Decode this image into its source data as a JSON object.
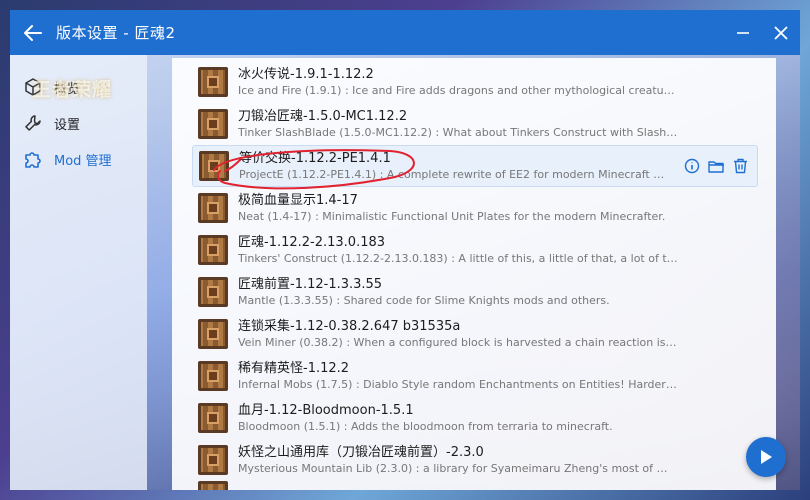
{
  "window": {
    "title": "版本设置 - 匠魂2",
    "accent": "#1f6fd1"
  },
  "sidebar": {
    "watermark": "王者荣耀",
    "items": [
      {
        "label": "概览",
        "icon": "cube-icon"
      },
      {
        "label": "设置",
        "icon": "wrench-icon"
      },
      {
        "label": "Mod 管理",
        "icon": "puzzle-icon",
        "active": true
      }
    ]
  },
  "mods": [
    {
      "name": "冰火传说-1.9.1-1.12.2",
      "desc": "Ice and Fire (1.9.1) : Ice and Fire adds dragons and other mythological creature..."
    },
    {
      "name": "刀锻冶匠魂-1.5.0-MC1.12.2",
      "desc": "Tinker SlashBlade (1.5.0-MC1.12.2) : What about Tinkers Construct with SlashBl..."
    },
    {
      "name": "等价交换-1.12.2-PE1.4.1",
      "desc": "ProjectE (1.12.2-PE1.4.1) : A complete rewrite of EE2 for modern Minecraft vers...",
      "selected": true
    },
    {
      "name": "极简血量显示1.4-17",
      "desc": "Neat (1.4-17) : Minimalistic Functional Unit Plates for the modern Minecrafter."
    },
    {
      "name": "匠魂-1.12.2-2.13.0.183",
      "desc": "Tinkers' Construct (1.12.2-2.13.0.183) : A little of this, a little of that, a lot of tink..."
    },
    {
      "name": "匠魂前置-1.12-1.3.3.55",
      "desc": "Mantle (1.3.3.55) : Shared code for Slime Knights mods and others."
    },
    {
      "name": "连锁采集-1.12-0.38.2.647 b31535a",
      "desc": "Vein Miner (0.38.2) : When a configured block is harvested a chain reaction is ini..."
    },
    {
      "name": "稀有精英怪-1.12.2",
      "desc": "Infernal Mobs (1.7.5) : Diablo Style random Enchantments on Entities! Harder fig..."
    },
    {
      "name": "血月-1.12-Bloodmoon-1.5.1",
      "desc": "Bloodmoon (1.5.1) : Adds the bloodmoon from terraria to minecraft."
    },
    {
      "name": "妖怪之山通用库（刀锻冶匠魂前置）-2.3.0",
      "desc": "Mysterious Mountain Lib (2.3.0) : a library for Syameimaru Zheng's most of mods."
    }
  ],
  "row_actions": [
    "info-icon",
    "folder-icon",
    "trash-icon"
  ],
  "fab_icon": "play-icon"
}
